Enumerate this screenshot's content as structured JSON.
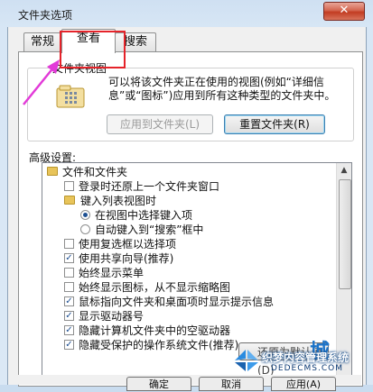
{
  "window": {
    "title": "文件夹选项",
    "close_label": "✕"
  },
  "tabs": [
    {
      "label": "常规"
    },
    {
      "label": "查看"
    },
    {
      "label": "搜索"
    }
  ],
  "folder_views": {
    "legend": "文件夹视图",
    "description": "可以将该文件夹正在使用的视图(例如“详细信息”或“图标”)应用到所有这种类型的文件夹中。",
    "apply_button": "应用到文件夹(L)",
    "reset_button": "重置文件夹(R)"
  },
  "advanced": {
    "label": "高级设置:",
    "items": [
      {
        "kind": "folder",
        "text": "文件和文件夹"
      },
      {
        "kind": "checkbox",
        "checked": false,
        "text": "登录时还原上一个文件夹窗口"
      },
      {
        "kind": "folder",
        "text": "键入列表视图时"
      },
      {
        "kind": "radio",
        "checked": true,
        "text": "在视图中选择键入项"
      },
      {
        "kind": "radio",
        "checked": false,
        "text": "自动键入到“搜索”框中"
      },
      {
        "kind": "checkbox",
        "checked": false,
        "text": "使用复选框以选择项"
      },
      {
        "kind": "checkbox",
        "checked": true,
        "text": "使用共享向导(推荐)"
      },
      {
        "kind": "checkbox",
        "checked": false,
        "text": "始终显示菜单"
      },
      {
        "kind": "checkbox",
        "checked": false,
        "text": "始终显示图标，从不显示缩略图"
      },
      {
        "kind": "checkbox",
        "checked": true,
        "text": "鼠标指向文件夹和桌面项时显示提示信息"
      },
      {
        "kind": "checkbox",
        "checked": true,
        "text": "显示驱动器号"
      },
      {
        "kind": "checkbox",
        "checked": true,
        "text": "隐藏计算机文件夹中的空驱动器"
      },
      {
        "kind": "checkbox",
        "checked": true,
        "text": "隐藏受保护的操作系统文件(推荐)"
      }
    ],
    "restore_defaults": "还原为默认值(D)"
  },
  "footer": {
    "ok": "确定",
    "cancel": "取消",
    "apply": "应用(A)"
  },
  "watermark": {
    "brand": "织梦内容管理系统",
    "domain": "DEDECMS.COM",
    "mark": "城"
  }
}
